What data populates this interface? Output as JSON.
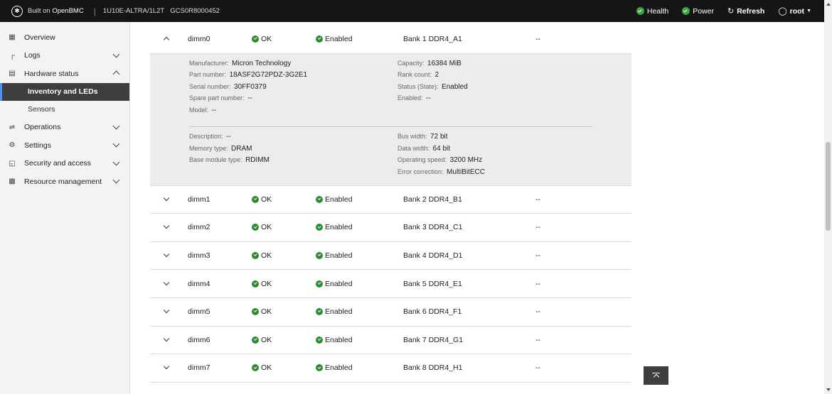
{
  "header": {
    "built_prefix": "Built on",
    "built_brand": "OpenBMC",
    "separator": "|",
    "host": "1U10E-ALTRA/1L2T",
    "serial": "GCS0R8000452",
    "health_label": "Health",
    "power_label": "Power",
    "refresh_label": "Refresh",
    "user_label": "root"
  },
  "sidebar": {
    "items": [
      {
        "label": "Overview",
        "icon": "overview-icon"
      },
      {
        "label": "Logs",
        "icon": "logs-icon"
      },
      {
        "label": "Hardware status",
        "icon": "hardware-icon"
      },
      {
        "label": "Operations",
        "icon": "operations-icon"
      },
      {
        "label": "Settings",
        "icon": "settings-icon"
      },
      {
        "label": "Security and access",
        "icon": "security-icon"
      },
      {
        "label": "Resource management",
        "icon": "resource-icon"
      }
    ],
    "sub_items": [
      "Inventory and LEDs",
      "Sensors"
    ],
    "active": "Inventory and LEDs"
  },
  "rows": [
    {
      "name": "dimm0",
      "health": "OK",
      "state": "Enabled",
      "location": "Bank 1 DDR4_A1",
      "part": "--",
      "expanded": true
    },
    {
      "name": "dimm1",
      "health": "OK",
      "state": "Enabled",
      "location": "Bank 2 DDR4_B1",
      "part": "--"
    },
    {
      "name": "dimm2",
      "health": "OK",
      "state": "Enabled",
      "location": "Bank 3 DDR4_C1",
      "part": "--"
    },
    {
      "name": "dimm3",
      "health": "OK",
      "state": "Enabled",
      "location": "Bank 4 DDR4_D1",
      "part": "--"
    },
    {
      "name": "dimm4",
      "health": "OK",
      "state": "Enabled",
      "location": "Bank 5 DDR4_E1",
      "part": "--"
    },
    {
      "name": "dimm5",
      "health": "OK",
      "state": "Enabled",
      "location": "Bank 6 DDR4_F1",
      "part": "--"
    },
    {
      "name": "dimm6",
      "health": "OK",
      "state": "Enabled",
      "location": "Bank 7 DDR4_G1",
      "part": "--"
    },
    {
      "name": "dimm7",
      "health": "OK",
      "state": "Enabled",
      "location": "Bank 8 DDR4_H1",
      "part": "--"
    }
  ],
  "details": {
    "left_top": [
      {
        "label": "Manufacturer:",
        "value": "Micron Technology"
      },
      {
        "label": "Part number:",
        "value": "18ASF2G72PDZ-3G2E1"
      },
      {
        "label": "Serial number:",
        "value": "30FF0379"
      },
      {
        "label": "Spare part number:",
        "value": "--"
      },
      {
        "label": "Model:",
        "value": "--"
      }
    ],
    "right_top": [
      {
        "label": "Capacity:",
        "value": "16384 MiB"
      },
      {
        "label": "Rank count:",
        "value": "2"
      },
      {
        "label": "Status (State):",
        "value": "Enabled"
      },
      {
        "label": "Enabled:",
        "value": "--"
      }
    ],
    "left_bottom": [
      {
        "label": "Description:",
        "value": "--"
      },
      {
        "label": "Memory type:",
        "value": "DRAM"
      },
      {
        "label": "Base module type:",
        "value": "RDIMM"
      }
    ],
    "right_bottom": [
      {
        "label": "Bus width:",
        "value": "72 bit"
      },
      {
        "label": "Data width:",
        "value": "64 bit"
      },
      {
        "label": "Operating speed:",
        "value": "3200 MHz"
      },
      {
        "label": "Error correction:",
        "value": "MultiBitECC"
      }
    ]
  },
  "colors": {
    "topbar": "#151515",
    "status_green": "#3aa540",
    "active_nav": "#3e3e3e",
    "active_accent": "#4d8ef7"
  }
}
